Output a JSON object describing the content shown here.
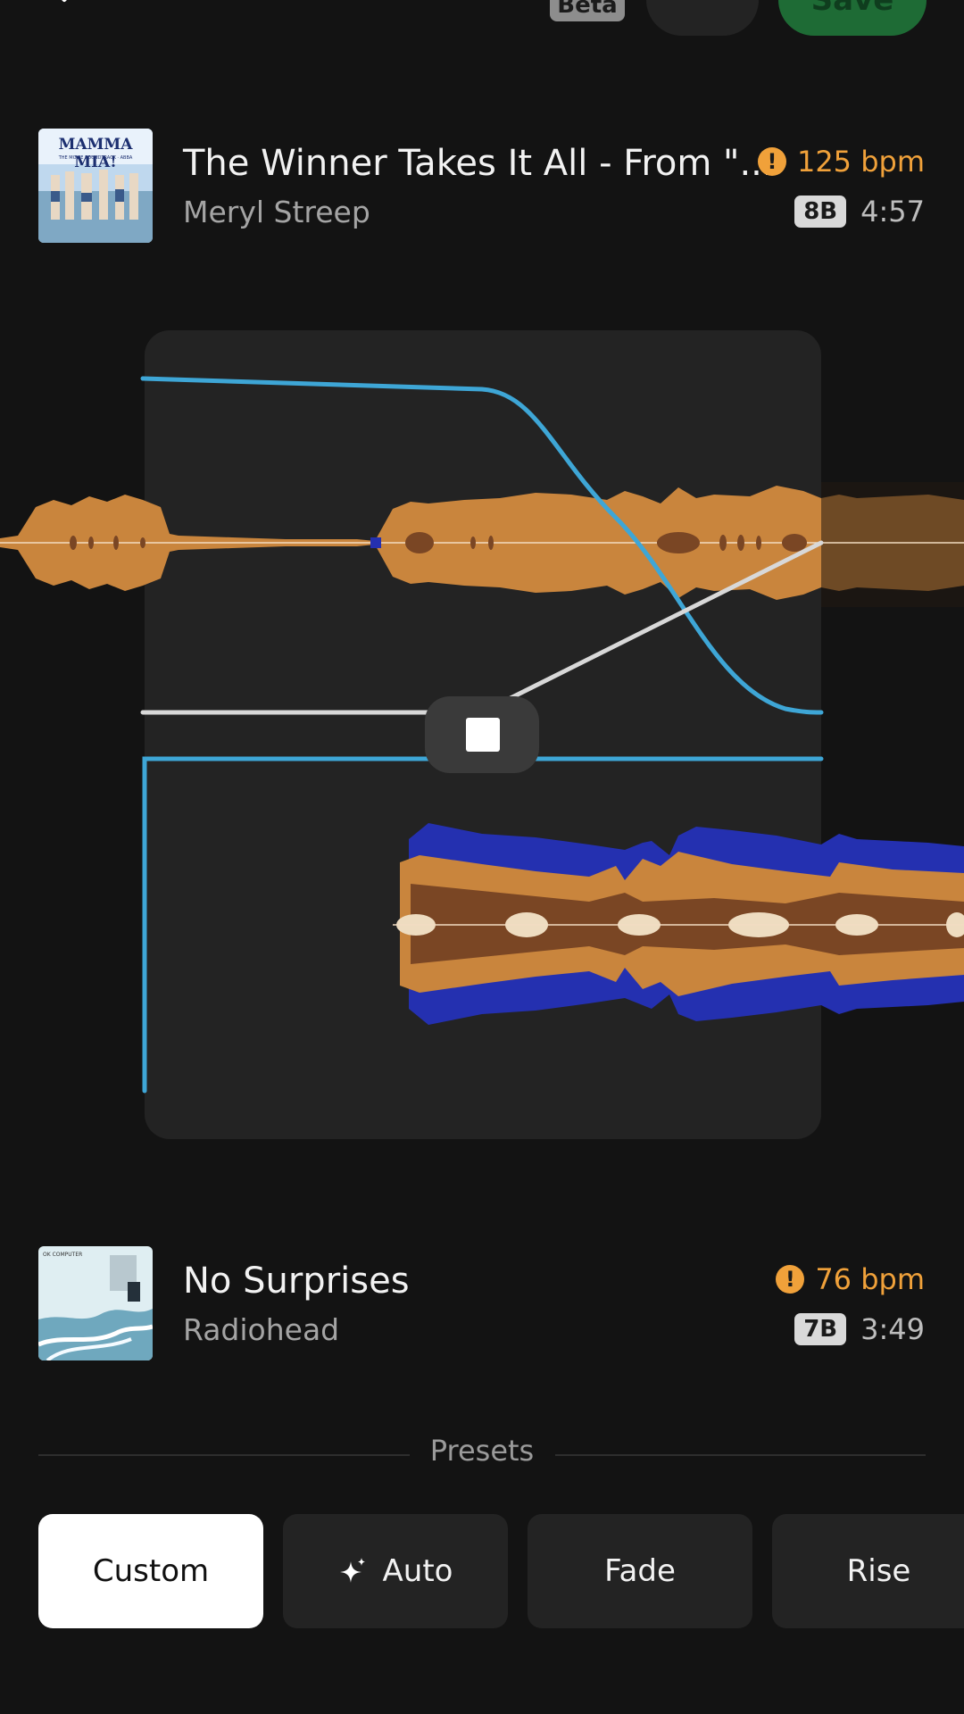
{
  "header": {
    "beta_label": "Beta",
    "more_label": "•••",
    "save_label": "Save"
  },
  "track_a": {
    "title": "The Winner Takes It All - From \"...",
    "artist": "Meryl Streep",
    "bpm": "125 bpm",
    "key": "8B",
    "duration": "4:57",
    "cover_text": "MAMMA MIA!",
    "cover_subtext": "THE MOVIE SOUNDTRACK · ABBA"
  },
  "track_b": {
    "title": "No Surprises",
    "artist": "Radiohead",
    "bpm": "76 bpm",
    "key": "7B",
    "duration": "3:49",
    "cover_text": "OK COMPUTER"
  },
  "presets": {
    "label": "Presets",
    "items": [
      {
        "label": "Custom",
        "active": true
      },
      {
        "label": "Auto",
        "icon": "sparkle-icon",
        "active": false
      },
      {
        "label": "Fade",
        "active": false
      },
      {
        "label": "Rise",
        "active": false
      }
    ]
  },
  "colors": {
    "accent_orange": "#f0a13a",
    "waveform_orange": "#c9853d",
    "waveform_brown": "#7a4624",
    "waveform_blue": "#2430b0",
    "curve_blue": "#3ea6d6",
    "curve_white": "#d8d8d8"
  }
}
